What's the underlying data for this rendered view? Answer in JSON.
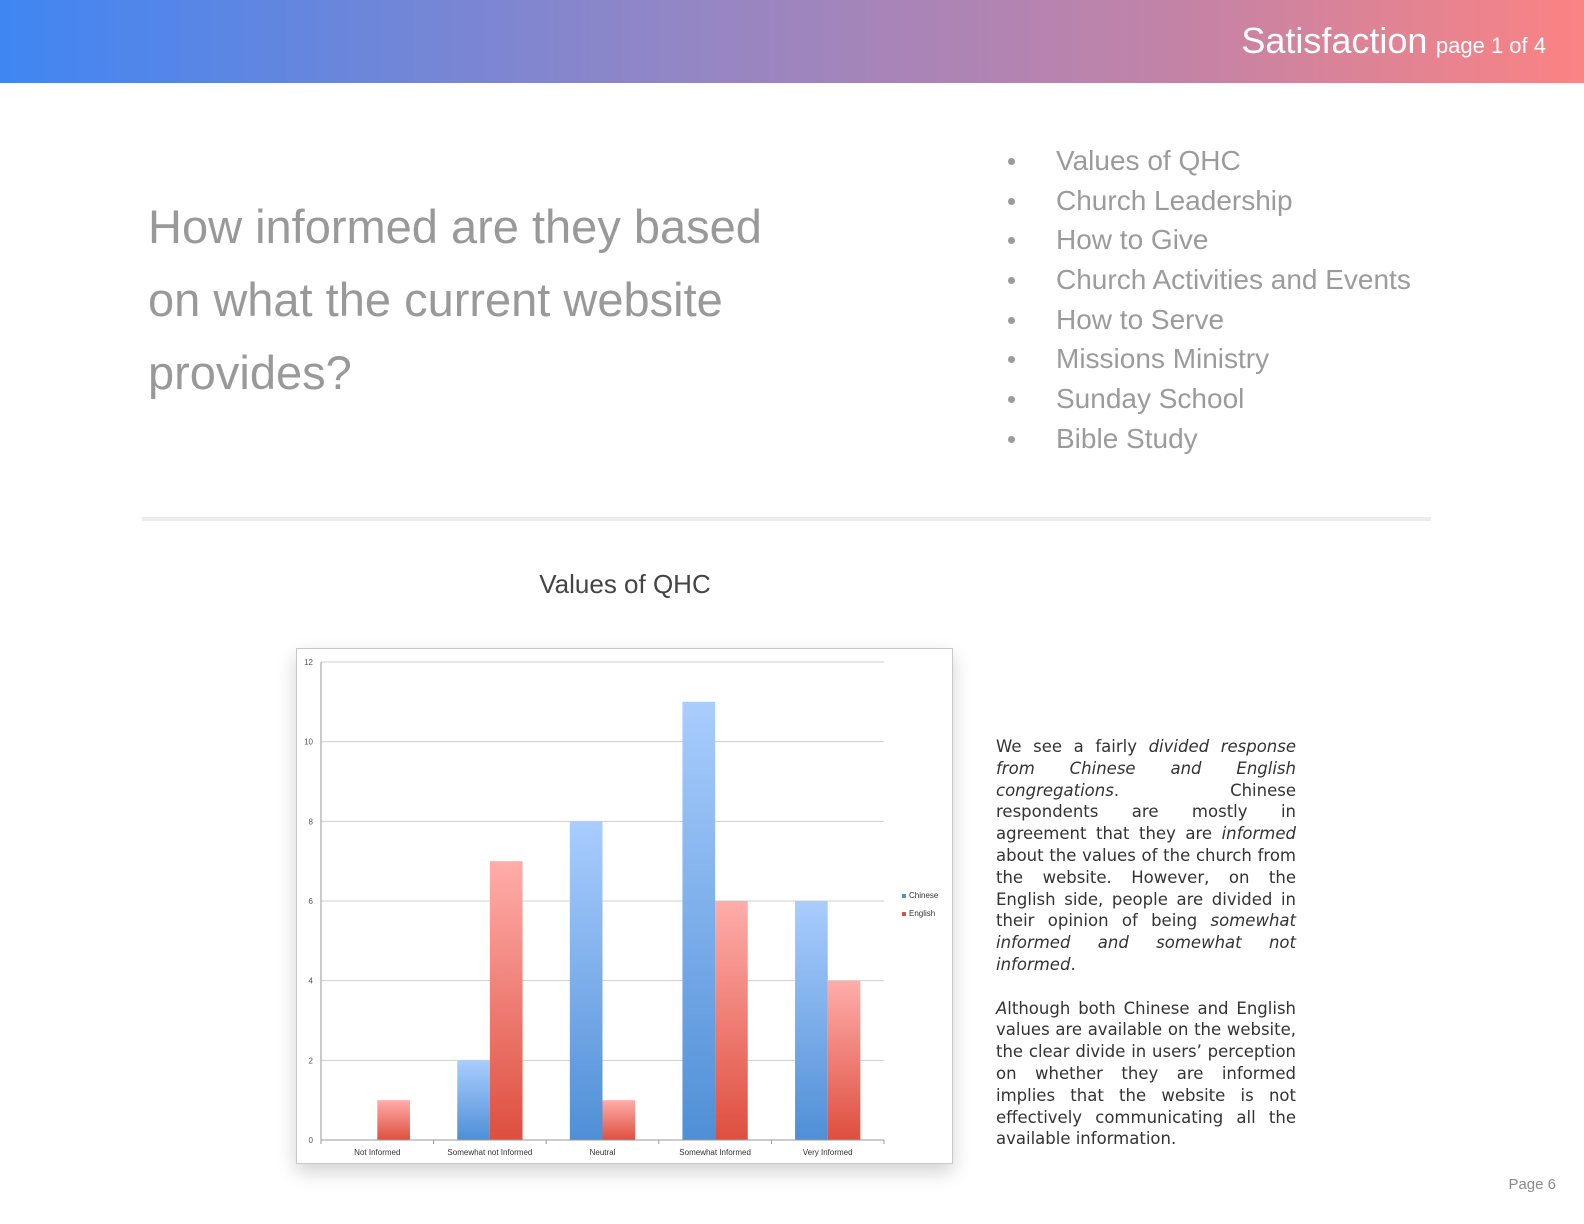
{
  "header": {
    "title": "Satisfaction",
    "subtitle": "page 1 of 4"
  },
  "question": "How informed are they based on what the current website provides?",
  "topics": [
    "Values of QHC",
    "Church Leadership",
    "How to Give",
    "Church Activities and Events",
    "How to Serve",
    "Missions Ministry",
    "Sunday School",
    "Bible Study"
  ],
  "chart_title": "Values of QHC",
  "chart_data": {
    "type": "bar",
    "categories": [
      "Not Informed",
      "Somewhat not Informed",
      "Neutral",
      "Somewhat Informed",
      "Very Informed"
    ],
    "series": [
      {
        "name": "Chinese",
        "values": [
          0,
          2,
          8,
          11,
          6
        ]
      },
      {
        "name": "English",
        "values": [
          1,
          7,
          1,
          6,
          4
        ]
      }
    ],
    "yticks": [
      "0",
      "2",
      "4",
      "6",
      "8",
      "10",
      "12"
    ],
    "ylim": [
      0,
      12
    ],
    "grid": true,
    "legend": "right",
    "colors": {
      "Chinese_top": "#a9cdfe",
      "Chinese_bottom": "#4f8fd6",
      "English_top": "#ffadaa",
      "English_bottom": "#de4f3f"
    }
  },
  "body": {
    "p1": [
      {
        "text": "We see a fairly ",
        "style": "normal"
      },
      {
        "text": "divided response from Chinese and English congregations",
        "style": "italic"
      },
      {
        "text": ". Chinese respondents are mostly in agreement that they are ",
        "style": "normal"
      },
      {
        "text": "informed",
        "style": "italic"
      },
      {
        "text": " about the values of the church from the website. However, on the English side, people are divided in their opinion of being ",
        "style": "normal"
      },
      {
        "text": "somewhat informed and somewhat not informed",
        "style": "italic"
      },
      {
        "text": ".",
        "style": "normal"
      }
    ],
    "p2": [
      {
        "text": "A",
        "style": "italic"
      },
      {
        "text": "lthough both Chinese and English values are available on the website, the clear divide in users’ perception on whether they are informed implies that the website is not effectively communicating all the available information.",
        "style": "normal"
      }
    ]
  },
  "page_number": "Page 6"
}
